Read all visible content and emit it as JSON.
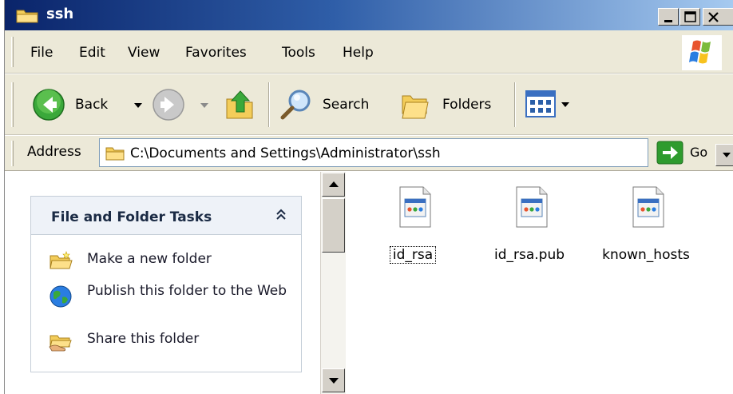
{
  "window": {
    "title": "ssh",
    "title_icon": "folder-icon",
    "caption_buttons": [
      "minimize-icon",
      "maximize-icon",
      "close-icon"
    ]
  },
  "menu": {
    "items": [
      "File",
      "Edit",
      "View",
      "Favorites",
      "Tools",
      "Help"
    ]
  },
  "toolbar": {
    "back_label": "Back",
    "search_label": "Search",
    "folders_label": "Folders"
  },
  "address": {
    "label": "Address",
    "value": "C:\\Documents and Settings\\Administrator\\ssh",
    "go_label": "Go"
  },
  "tasks": {
    "title": "File and Folder Tasks",
    "items": [
      {
        "label": "Make a new folder",
        "icon": "new-folder-icon"
      },
      {
        "label": "Publish this folder to the Web",
        "icon": "globe-icon"
      },
      {
        "label": "Share this folder",
        "icon": "share-folder-icon"
      }
    ]
  },
  "files": [
    {
      "name": "id_rsa",
      "selected": true
    },
    {
      "name": "id_rsa.pub",
      "selected": false
    },
    {
      "name": "known_hosts",
      "selected": false
    }
  ],
  "colors": {
    "title_start": "#0a246a",
    "title_end": "#a6caf0",
    "chrome": "#ece9d8",
    "go_green": "#2e9b2e"
  }
}
